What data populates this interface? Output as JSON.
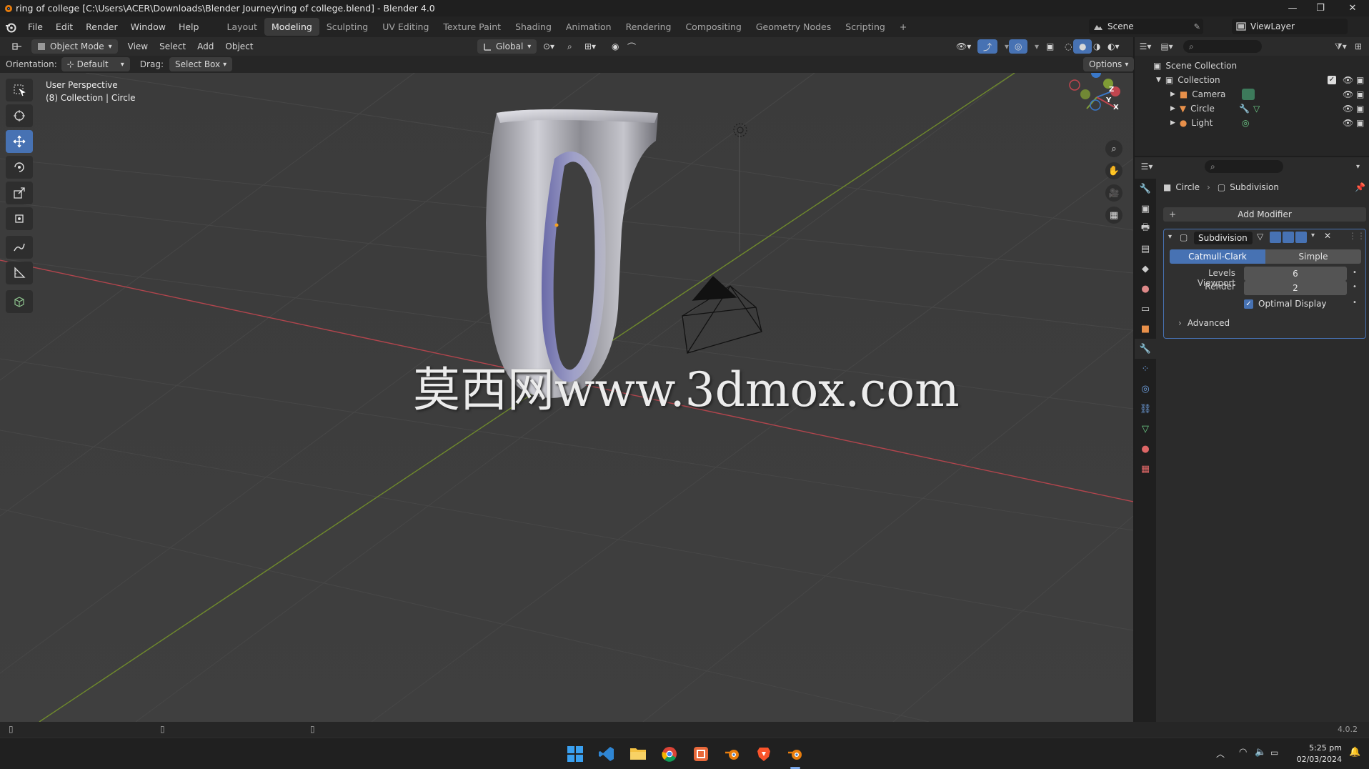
{
  "window": {
    "title": "ring of college [C:\\Users\\ACER\\Downloads\\Blender Journey\\ring of college.blend] - Blender 4.0",
    "minimize": "—",
    "maximize": "❐",
    "close": "✕"
  },
  "menubar": {
    "menus": [
      "File",
      "Edit",
      "Render",
      "Window",
      "Help"
    ],
    "workspaces": [
      "Layout",
      "Modeling",
      "Sculpting",
      "UV Editing",
      "Texture Paint",
      "Shading",
      "Animation",
      "Rendering",
      "Compositing",
      "Geometry Nodes",
      "Scripting"
    ],
    "active_workspace": "Modeling",
    "add_workspace": "+",
    "scene_label": "Scene",
    "viewlayer_label": "ViewLayer"
  },
  "viewport_header": {
    "mode": "Object Mode",
    "menus": [
      "View",
      "Select",
      "Add",
      "Object"
    ],
    "transform_orientation": "Global",
    "options": "Options"
  },
  "tool_settings": {
    "orientation_label": "Orientation:",
    "orientation_value": "Default",
    "drag_label": "Drag:",
    "drag_value": "Select Box"
  },
  "viewport": {
    "perspective_label": "User Perspective",
    "collection_label": "(8) Collection | Circle",
    "watermark": "莫西网www.3dmox.com",
    "gizmo_axes": [
      "X",
      "Y",
      "Z"
    ]
  },
  "outliner": {
    "root": "Scene Collection",
    "collection": "Collection",
    "items": [
      "Camera",
      "Circle",
      "Light"
    ]
  },
  "properties": {
    "breadcrumb_object": "Circle",
    "breadcrumb_modifier": "Subdivision",
    "add_modifier": "Add Modifier",
    "modifier_name": "Subdivision",
    "type_options": [
      "Catmull-Clark",
      "Simple"
    ],
    "active_type": "Catmull-Clark",
    "levels_viewport_label": "Levels Viewport",
    "levels_viewport_value": "6",
    "render_label": "Render",
    "render_value": "2",
    "optimal_display_label": "Optimal Display",
    "optimal_display_checked": true,
    "advanced_label": "Advanced"
  },
  "statusbar": {
    "version": "4.0.2"
  },
  "taskbar": {
    "time": "5:25 pm",
    "date": "02/03/2024"
  },
  "colors": {
    "accent_blue": "#4772b3",
    "x_axis": "#c0454e",
    "y_axis": "#7f9c35",
    "z_axis": "#3a78c9"
  }
}
